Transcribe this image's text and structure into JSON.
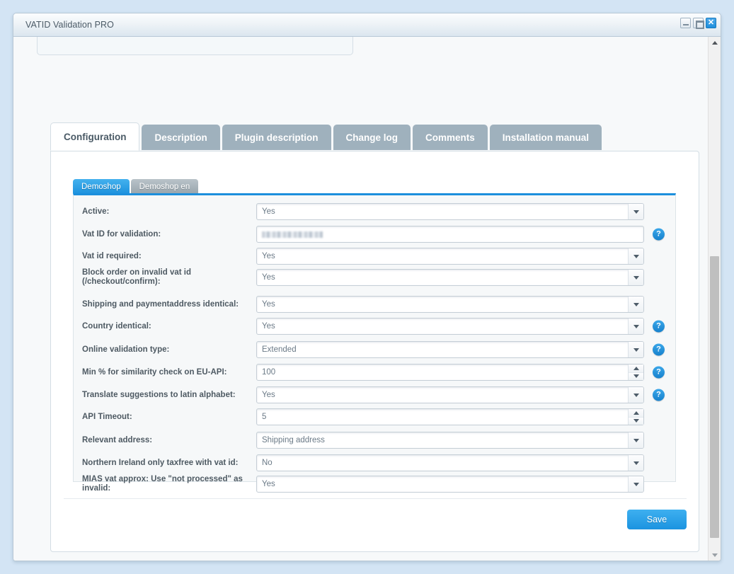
{
  "window": {
    "title": "VATID Validation PRO",
    "controls": {
      "minimize": "minimize-button",
      "maximize": "maximize-button",
      "close": "✕"
    }
  },
  "tabs": [
    {
      "label": "Configuration",
      "active": true
    },
    {
      "label": "Description",
      "active": false
    },
    {
      "label": "Plugin description",
      "active": false
    },
    {
      "label": "Change log",
      "active": false
    },
    {
      "label": "Comments",
      "active": false
    },
    {
      "label": "Installation manual",
      "active": false
    }
  ],
  "subtabs": [
    {
      "label": "Demoshop",
      "active": true
    },
    {
      "label": "Demoshop en",
      "active": false
    }
  ],
  "form": {
    "fields": [
      {
        "label": "Active:",
        "value": "Yes",
        "control": "select",
        "help": false
      },
      {
        "label": "Vat ID for validation:",
        "value": "",
        "control": "text-redacted",
        "help": true
      },
      {
        "label": "Vat id required:",
        "value": "Yes",
        "control": "select",
        "help": false
      },
      {
        "label": "Block order on invalid vat id (/checkout/confirm):",
        "value": "Yes",
        "control": "select",
        "help": false
      },
      {
        "label": "Shipping and paymentaddress identical:",
        "value": "Yes",
        "control": "select",
        "help": false
      },
      {
        "label": "Country identical:",
        "value": "Yes",
        "control": "select",
        "help": true
      },
      {
        "label": "Online validation type:",
        "value": "Extended",
        "control": "select",
        "help": true
      },
      {
        "label": "Min % for similarity check on EU-API:",
        "value": "100",
        "control": "spinner",
        "help": true
      },
      {
        "label": "Translate suggestions to latin alphabet:",
        "value": "Yes",
        "control": "select",
        "help": true
      },
      {
        "label": "API Timeout:",
        "value": "5",
        "control": "spinner",
        "help": false
      },
      {
        "label": "Relevant address:",
        "value": "Shipping address",
        "control": "select",
        "help": false
      },
      {
        "label": "Northern Ireland only taxfree with vat id:",
        "value": "No",
        "control": "select",
        "help": false
      },
      {
        "label": "MIAS vat approx: Use \"not processed\" as invalid:",
        "value": "Yes",
        "control": "select",
        "help": false
      }
    ],
    "help_glyph": "?",
    "save_label": "Save"
  },
  "colors": {
    "accent_blue": "#1b91dd",
    "tab_inactive": "#9fb1bd",
    "page_bg": "#d3e4f4",
    "panel_bg": "#f6f8f9"
  }
}
